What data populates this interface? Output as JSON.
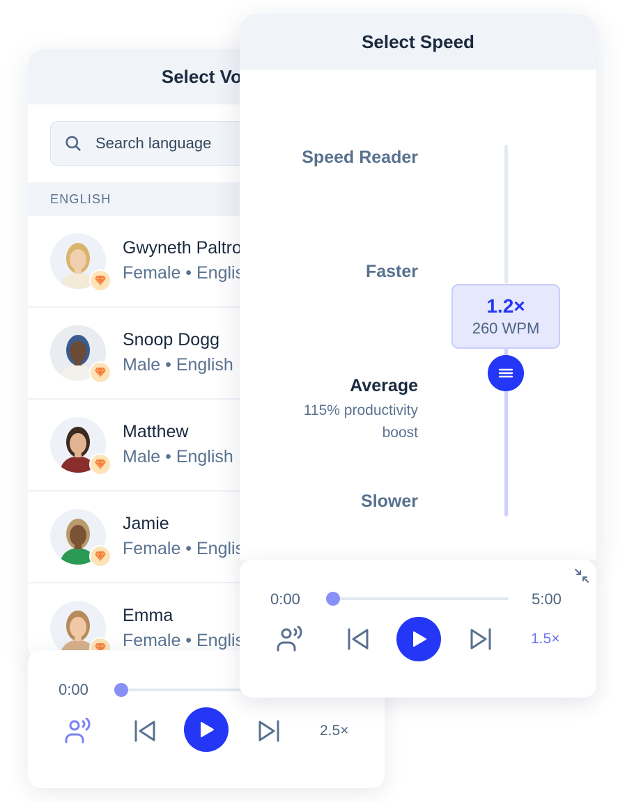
{
  "voice_panel": {
    "title": "Select Voice",
    "search": {
      "placeholder": "Search language",
      "value": ""
    },
    "section_label": "ENGLISH",
    "voices": [
      {
        "name": "Gwyneth Paltrow",
        "meta": "Female • English",
        "premium": true,
        "avatar_bg": "#eef2f8",
        "hair": "#d9b46a",
        "skin": "#f1cfae",
        "shirt": "#f3ead8"
      },
      {
        "name": "Snoop Dogg",
        "meta": "Male • English",
        "premium": true,
        "avatar_bg": "#e9ecf0",
        "hair": "#3b5b8e",
        "skin": "#6b4a36",
        "shirt": "#f2f1ec"
      },
      {
        "name": "Matthew",
        "meta": "Male • English",
        "premium": true,
        "avatar_bg": "#eef2f8",
        "hair": "#3a2a20",
        "skin": "#e2b492",
        "shirt": "#8a2d2d"
      },
      {
        "name": "Jamie",
        "meta": "Female • English",
        "premium": true,
        "avatar_bg": "#eef2f8",
        "hair": "#b99a6a",
        "skin": "#7a5236",
        "shirt": "#2a9a55"
      },
      {
        "name": "Emma",
        "meta": "Female • English",
        "premium": true,
        "avatar_bg": "#eef2f8",
        "hair": "#b68a5a",
        "skin": "#f0c8a8",
        "shirt": "#d6b08a"
      }
    ]
  },
  "mini_player": {
    "current_time": "0:00",
    "progress_percent": 0,
    "speed": "2.5×"
  },
  "speed_panel": {
    "title": "Select Speed",
    "options": [
      {
        "label": "Speed Reader",
        "active": false
      },
      {
        "label": "Faster",
        "active": false
      },
      {
        "label": "Average",
        "active": true,
        "description": "115% productivity boost"
      },
      {
        "label": "Slower",
        "active": false
      }
    ],
    "current": {
      "speed": "1.2×",
      "wpm": "260 WPM"
    }
  },
  "player": {
    "current_time": "0:00",
    "total_time": "5:00",
    "progress_percent": 0,
    "speed": "1.5×"
  },
  "colors": {
    "accent": "#2437f7",
    "accent_light": "#8890f8",
    "text_primary": "#1b2a3f",
    "text_secondary": "#5a7391",
    "header_bg": "#f0f3f8",
    "premium_badge": "#fde3b8",
    "premium_icon": "#f5793a"
  }
}
